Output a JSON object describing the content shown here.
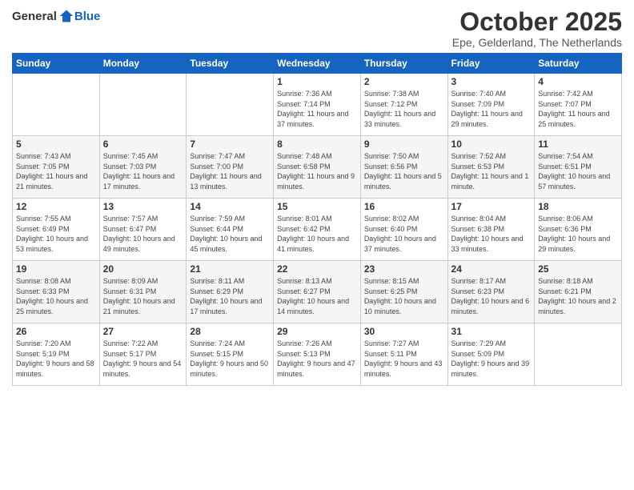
{
  "logo": {
    "general": "General",
    "blue": "Blue"
  },
  "title": "October 2025",
  "subtitle": "Epe, Gelderland, The Netherlands",
  "weekdays": [
    "Sunday",
    "Monday",
    "Tuesday",
    "Wednesday",
    "Thursday",
    "Friday",
    "Saturday"
  ],
  "weeks": [
    [
      {
        "day": "",
        "sunrise": "",
        "sunset": "",
        "daylight": ""
      },
      {
        "day": "",
        "sunrise": "",
        "sunset": "",
        "daylight": ""
      },
      {
        "day": "",
        "sunrise": "",
        "sunset": "",
        "daylight": ""
      },
      {
        "day": "1",
        "sunrise": "Sunrise: 7:36 AM",
        "sunset": "Sunset: 7:14 PM",
        "daylight": "Daylight: 11 hours and 37 minutes."
      },
      {
        "day": "2",
        "sunrise": "Sunrise: 7:38 AM",
        "sunset": "Sunset: 7:12 PM",
        "daylight": "Daylight: 11 hours and 33 minutes."
      },
      {
        "day": "3",
        "sunrise": "Sunrise: 7:40 AM",
        "sunset": "Sunset: 7:09 PM",
        "daylight": "Daylight: 11 hours and 29 minutes."
      },
      {
        "day": "4",
        "sunrise": "Sunrise: 7:42 AM",
        "sunset": "Sunset: 7:07 PM",
        "daylight": "Daylight: 11 hours and 25 minutes."
      }
    ],
    [
      {
        "day": "5",
        "sunrise": "Sunrise: 7:43 AM",
        "sunset": "Sunset: 7:05 PM",
        "daylight": "Daylight: 11 hours and 21 minutes."
      },
      {
        "day": "6",
        "sunrise": "Sunrise: 7:45 AM",
        "sunset": "Sunset: 7:03 PM",
        "daylight": "Daylight: 11 hours and 17 minutes."
      },
      {
        "day": "7",
        "sunrise": "Sunrise: 7:47 AM",
        "sunset": "Sunset: 7:00 PM",
        "daylight": "Daylight: 11 hours and 13 minutes."
      },
      {
        "day": "8",
        "sunrise": "Sunrise: 7:48 AM",
        "sunset": "Sunset: 6:58 PM",
        "daylight": "Daylight: 11 hours and 9 minutes."
      },
      {
        "day": "9",
        "sunrise": "Sunrise: 7:50 AM",
        "sunset": "Sunset: 6:56 PM",
        "daylight": "Daylight: 11 hours and 5 minutes."
      },
      {
        "day": "10",
        "sunrise": "Sunrise: 7:52 AM",
        "sunset": "Sunset: 6:53 PM",
        "daylight": "Daylight: 11 hours and 1 minute."
      },
      {
        "day": "11",
        "sunrise": "Sunrise: 7:54 AM",
        "sunset": "Sunset: 6:51 PM",
        "daylight": "Daylight: 10 hours and 57 minutes."
      }
    ],
    [
      {
        "day": "12",
        "sunrise": "Sunrise: 7:55 AM",
        "sunset": "Sunset: 6:49 PM",
        "daylight": "Daylight: 10 hours and 53 minutes."
      },
      {
        "day": "13",
        "sunrise": "Sunrise: 7:57 AM",
        "sunset": "Sunset: 6:47 PM",
        "daylight": "Daylight: 10 hours and 49 minutes."
      },
      {
        "day": "14",
        "sunrise": "Sunrise: 7:59 AM",
        "sunset": "Sunset: 6:44 PM",
        "daylight": "Daylight: 10 hours and 45 minutes."
      },
      {
        "day": "15",
        "sunrise": "Sunrise: 8:01 AM",
        "sunset": "Sunset: 6:42 PM",
        "daylight": "Daylight: 10 hours and 41 minutes."
      },
      {
        "day": "16",
        "sunrise": "Sunrise: 8:02 AM",
        "sunset": "Sunset: 6:40 PM",
        "daylight": "Daylight: 10 hours and 37 minutes."
      },
      {
        "day": "17",
        "sunrise": "Sunrise: 8:04 AM",
        "sunset": "Sunset: 6:38 PM",
        "daylight": "Daylight: 10 hours and 33 minutes."
      },
      {
        "day": "18",
        "sunrise": "Sunrise: 8:06 AM",
        "sunset": "Sunset: 6:36 PM",
        "daylight": "Daylight: 10 hours and 29 minutes."
      }
    ],
    [
      {
        "day": "19",
        "sunrise": "Sunrise: 8:08 AM",
        "sunset": "Sunset: 6:33 PM",
        "daylight": "Daylight: 10 hours and 25 minutes."
      },
      {
        "day": "20",
        "sunrise": "Sunrise: 8:09 AM",
        "sunset": "Sunset: 6:31 PM",
        "daylight": "Daylight: 10 hours and 21 minutes."
      },
      {
        "day": "21",
        "sunrise": "Sunrise: 8:11 AM",
        "sunset": "Sunset: 6:29 PM",
        "daylight": "Daylight: 10 hours and 17 minutes."
      },
      {
        "day": "22",
        "sunrise": "Sunrise: 8:13 AM",
        "sunset": "Sunset: 6:27 PM",
        "daylight": "Daylight: 10 hours and 14 minutes."
      },
      {
        "day": "23",
        "sunrise": "Sunrise: 8:15 AM",
        "sunset": "Sunset: 6:25 PM",
        "daylight": "Daylight: 10 hours and 10 minutes."
      },
      {
        "day": "24",
        "sunrise": "Sunrise: 8:17 AM",
        "sunset": "Sunset: 6:23 PM",
        "daylight": "Daylight: 10 hours and 6 minutes."
      },
      {
        "day": "25",
        "sunrise": "Sunrise: 8:18 AM",
        "sunset": "Sunset: 6:21 PM",
        "daylight": "Daylight: 10 hours and 2 minutes."
      }
    ],
    [
      {
        "day": "26",
        "sunrise": "Sunrise: 7:20 AM",
        "sunset": "Sunset: 5:19 PM",
        "daylight": "Daylight: 9 hours and 58 minutes."
      },
      {
        "day": "27",
        "sunrise": "Sunrise: 7:22 AM",
        "sunset": "Sunset: 5:17 PM",
        "daylight": "Daylight: 9 hours and 54 minutes."
      },
      {
        "day": "28",
        "sunrise": "Sunrise: 7:24 AM",
        "sunset": "Sunset: 5:15 PM",
        "daylight": "Daylight: 9 hours and 50 minutes."
      },
      {
        "day": "29",
        "sunrise": "Sunrise: 7:26 AM",
        "sunset": "Sunset: 5:13 PM",
        "daylight": "Daylight: 9 hours and 47 minutes."
      },
      {
        "day": "30",
        "sunrise": "Sunrise: 7:27 AM",
        "sunset": "Sunset: 5:11 PM",
        "daylight": "Daylight: 9 hours and 43 minutes."
      },
      {
        "day": "31",
        "sunrise": "Sunrise: 7:29 AM",
        "sunset": "Sunset: 5:09 PM",
        "daylight": "Daylight: 9 hours and 39 minutes."
      },
      {
        "day": "",
        "sunrise": "",
        "sunset": "",
        "daylight": ""
      }
    ]
  ]
}
